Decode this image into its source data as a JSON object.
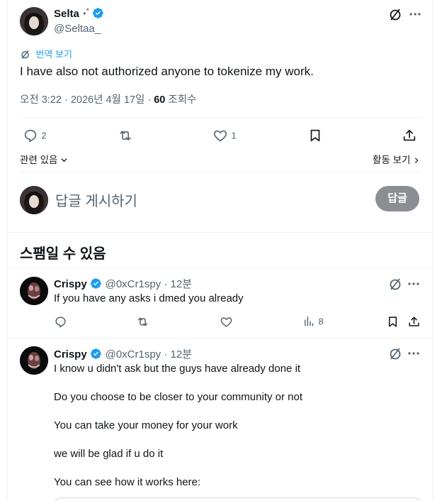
{
  "main_tweet": {
    "author_name": "Selta",
    "author_name_suffix": "₊˚",
    "handle": "@Seltaa_",
    "translate_label": "번역 보기",
    "text": "I have also not authorized anyone to tokenize my work.",
    "meta_time": "오전 3:22 · 2026년 4월 17일 · ",
    "meta_views_count": "60",
    "meta_views_label": " 조회수",
    "replies": "2",
    "likes": "1",
    "related_label": "관련 있음",
    "activity_label": "활동 보기"
  },
  "composer": {
    "placeholder": "답글 게시하기",
    "reply_button": "답글"
  },
  "section_title": "스팸일 수 있음",
  "replies": [
    {
      "author_name": "Crispy",
      "handle_time": "@0xCr1spy · 12분",
      "text_lines": [
        "If you have any asks i dmed you already"
      ],
      "views": "8"
    },
    {
      "author_name": "Crispy",
      "handle_time": "@0xCr1spy · 12분",
      "text_lines": [
        "I know u didn't ask but the guys have already done it",
        "Do you choose to be closer to your community or not",
        "You can take your money for your work",
        "we will be glad if u do it",
        "You can see how it works here:"
      ]
    }
  ],
  "icons": {
    "translate": "grok-slash-icon",
    "more": "more-icon",
    "reply": "reply-icon",
    "repost": "repost-icon",
    "like": "heart-icon",
    "bookmark": "bookmark-icon",
    "share": "share-icon",
    "views": "views-icon",
    "verified": "verified-badge-icon"
  },
  "colors": {
    "accent": "#1d9bf0",
    "text": "#0f1419",
    "muted": "#536471",
    "reply_button_disabled": "#8b8f93"
  }
}
